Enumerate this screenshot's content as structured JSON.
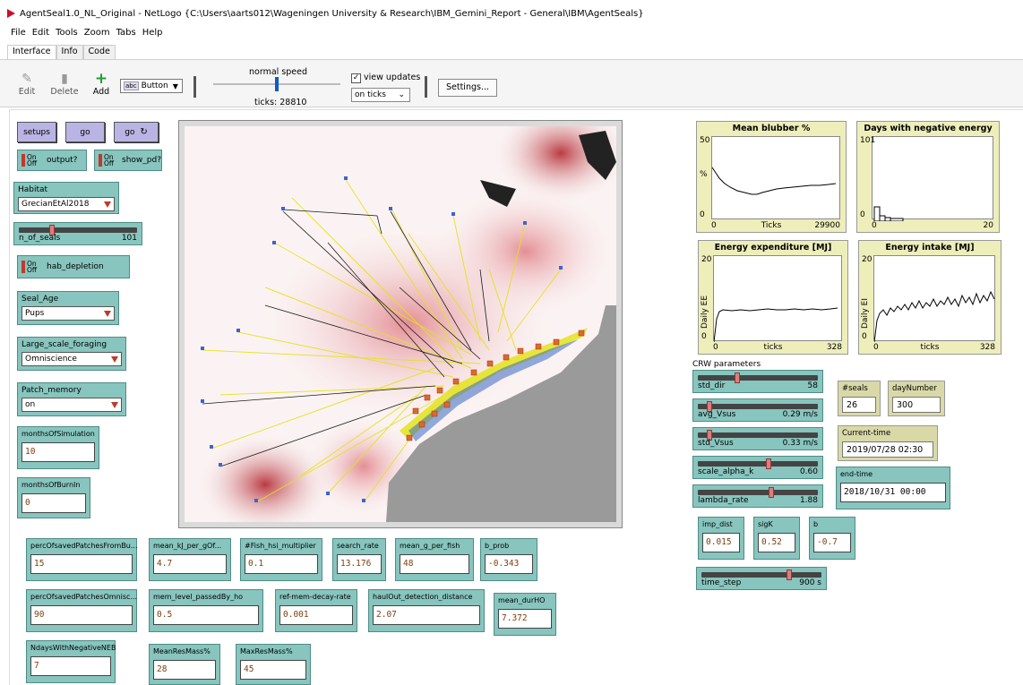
{
  "window": {
    "title": "AgentSeal1.0_NL_Original - NetLogo {C:\\Users\\aarts012\\Wageningen University & Research\\IBM_Gemini_Report - General\\IBM\\AgentSeals}"
  },
  "menu": [
    "File",
    "Edit",
    "Tools",
    "Zoom",
    "Tabs",
    "Help"
  ],
  "tabs": [
    "Interface",
    "Info",
    "Code"
  ],
  "toolbar": {
    "edit_label": "Edit",
    "delete_label": "Delete",
    "add_label": "Add",
    "widget_type": "Button",
    "speed_label": "normal speed",
    "speed_fraction": 0.5,
    "ticks_label": "ticks: 28810",
    "view_updates_label": "view updates",
    "view_updates_checked": true,
    "update_mode": "on ticks",
    "settings_label": "Settings..."
  },
  "buttons": {
    "setups": "setups",
    "go": "go",
    "go_forever": "go"
  },
  "switches": {
    "output": {
      "label": "output?",
      "on": "On",
      "off": "Off"
    },
    "show_pd": {
      "label": "show_pd?",
      "on": "On",
      "off": "Off"
    },
    "hab_depletion": {
      "label": "hab_depletion",
      "on": "On",
      "off": "Off"
    }
  },
  "choosers": {
    "habitat": {
      "label": "Habitat",
      "value": "GrecianEtAl2018"
    },
    "seal_age": {
      "label": "Seal_Age",
      "value": "Pups"
    },
    "large_scale_foraging": {
      "label": "Large_scale_foraging",
      "value": "Omniscience"
    },
    "patch_memory": {
      "label": "Patch_memory",
      "value": "on"
    }
  },
  "sliders": {
    "n_of_seals": {
      "label": "n_of_seals",
      "value": "101",
      "fraction": 0.27
    },
    "std_dir": {
      "label": "std_dir",
      "value": "58",
      "fraction": 0.32
    },
    "avg_vsus": {
      "label": "avg_Vsus",
      "value": "0.29 m/s",
      "fraction": 0.08
    },
    "std_vsus": {
      "label": "std_Vsus",
      "value": "0.33 m/s",
      "fraction": 0.08
    },
    "scale_alpha_k": {
      "label": "scale_alpha_k",
      "value": "0.60",
      "fraction": 0.59
    },
    "lambda_rate": {
      "label": "lambda_rate",
      "value": "1.88",
      "fraction": 0.62
    },
    "time_step": {
      "label": "time_step",
      "value": "900 s",
      "fraction": 0.74
    }
  },
  "inputs": {
    "months_of_simulation": {
      "label": "monthsOfSimulation",
      "value": "10"
    },
    "months_of_burnin": {
      "label": "monthsOfBurnIn",
      "value": "0"
    },
    "perc_saved_bu": {
      "label": "percOfsavedPatchesFromBu...",
      "value": "15"
    },
    "mean_kj_per_g": {
      "label": "mean_kJ_per_gOf...",
      "value": "4.7"
    },
    "fish_hsi_multiplier": {
      "label": "#Fish_hsi_multiplier",
      "value": "0.1"
    },
    "search_rate": {
      "label": "search_rate",
      "value": "13.176"
    },
    "mean_g_per_fish": {
      "label": "mean_g_per_fish",
      "value": "48"
    },
    "b_prob": {
      "label": "b_prob",
      "value": "-0.343"
    },
    "perc_saved_omni": {
      "label": "percOfsavedPatchesOmnisc...",
      "value": "90"
    },
    "mem_level": {
      "label": "mem_level_passedBy_ho",
      "value": "0.5"
    },
    "ref_mem_decay": {
      "label": "ref-mem-decay-rate",
      "value": "0.001"
    },
    "haulout_distance": {
      "label": "haulOut_detection_distance",
      "value": "2.07"
    },
    "mean_durho": {
      "label": "mean_durHO",
      "value": "7.372"
    },
    "ndays_negative_neb": {
      "label": "NdaysWithNegativeNEB",
      "value": "7"
    },
    "mean_res_mass": {
      "label": "MeanResMass%",
      "value": "28"
    },
    "max_res_mass": {
      "label": "MaxResMass%",
      "value": "45"
    },
    "imp_dist": {
      "label": "imp_dist",
      "value": "0.015"
    },
    "sigk": {
      "label": "sigK",
      "value": "0.52"
    },
    "b": {
      "label": "b",
      "value": "-0.7"
    }
  },
  "monitors": {
    "nseals": {
      "label": "#seals",
      "value": "26"
    },
    "daynumber": {
      "label": "dayNumber",
      "value": "300"
    },
    "current_time": {
      "label": "Current-time",
      "value": "2019/07/28 02:30"
    },
    "end_time": {
      "label": "end-time",
      "value": "2018/10/31 00:00"
    }
  },
  "crw_label": "CRW parameters",
  "plots": {
    "blubber": {
      "title": "Mean blubber %",
      "ymax": "50",
      "ymin": "0",
      "xmin": "0",
      "xmax": "29900",
      "xlabel": "Ticks",
      "ylabel": "%"
    },
    "neg_energy": {
      "title": "Days with negative energy",
      "ymax": "101",
      "ymin": "0",
      "xmin": "0",
      "xmax": "20",
      "xlabel": "",
      "ylabel": ""
    },
    "expenditure": {
      "title": "Energy expenditure [MJ]",
      "ymax": "20",
      "ymin": "0",
      "xmin": "0",
      "xmax": "328",
      "xlabel": "ticks",
      "ylabel": "Daily EE"
    },
    "intake": {
      "title": "Energy intake [MJ]",
      "ymax": "20",
      "ymin": "0",
      "xmin": "0",
      "xmax": "328",
      "xlabel": "ticks",
      "ylabel": "Daily EI"
    }
  },
  "colors": {
    "button": "#bab4e4",
    "widget": "#87c5be",
    "monitor": "#d9d9a8",
    "plot": "#eeeebb",
    "title_icon": "#c8102e"
  }
}
